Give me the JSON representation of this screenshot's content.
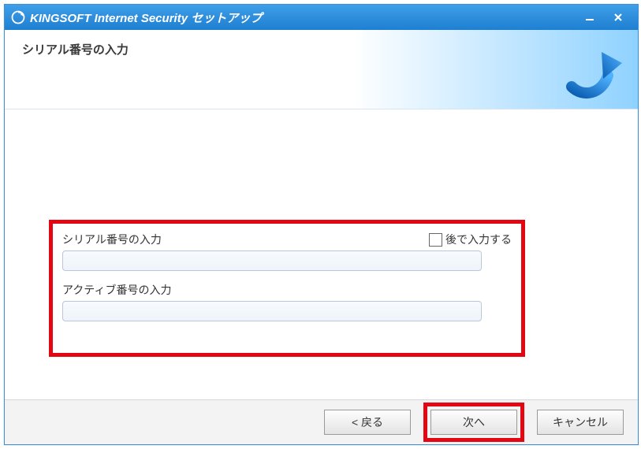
{
  "titlebar": {
    "app_title": "KINGSOFT Internet Security セットアップ"
  },
  "header": {
    "page_title": "シリアル番号の入力"
  },
  "form": {
    "serial": {
      "label": "シリアル番号の入力",
      "value": "",
      "later_checkbox_label": "後で入力する",
      "later_checked": false
    },
    "active": {
      "label": "アクティブ番号の入力",
      "value": ""
    }
  },
  "footer": {
    "back_label": "< 戻る",
    "next_label": "次へ",
    "cancel_label": "キャンセル"
  },
  "icons": {
    "app": "shield-refresh-icon",
    "minimize": "minimize-icon",
    "close": "close-icon",
    "header_art": "upward-arrow-icon"
  }
}
